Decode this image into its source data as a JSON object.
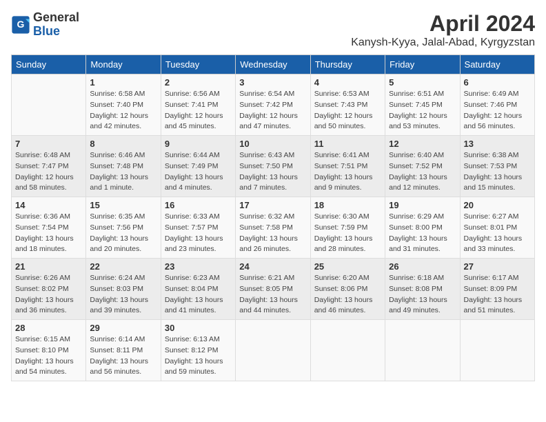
{
  "header": {
    "logo_line1": "General",
    "logo_line2": "Blue",
    "title": "April 2024",
    "location": "Kanysh-Kyya, Jalal-Abad, Kyrgyzstan"
  },
  "weekdays": [
    "Sunday",
    "Monday",
    "Tuesday",
    "Wednesday",
    "Thursday",
    "Friday",
    "Saturday"
  ],
  "weeks": [
    [
      {
        "day": "",
        "info": ""
      },
      {
        "day": "1",
        "info": "Sunrise: 6:58 AM\nSunset: 7:40 PM\nDaylight: 12 hours\nand 42 minutes."
      },
      {
        "day": "2",
        "info": "Sunrise: 6:56 AM\nSunset: 7:41 PM\nDaylight: 12 hours\nand 45 minutes."
      },
      {
        "day": "3",
        "info": "Sunrise: 6:54 AM\nSunset: 7:42 PM\nDaylight: 12 hours\nand 47 minutes."
      },
      {
        "day": "4",
        "info": "Sunrise: 6:53 AM\nSunset: 7:43 PM\nDaylight: 12 hours\nand 50 minutes."
      },
      {
        "day": "5",
        "info": "Sunrise: 6:51 AM\nSunset: 7:45 PM\nDaylight: 12 hours\nand 53 minutes."
      },
      {
        "day": "6",
        "info": "Sunrise: 6:49 AM\nSunset: 7:46 PM\nDaylight: 12 hours\nand 56 minutes."
      }
    ],
    [
      {
        "day": "7",
        "info": "Sunrise: 6:48 AM\nSunset: 7:47 PM\nDaylight: 12 hours\nand 58 minutes."
      },
      {
        "day": "8",
        "info": "Sunrise: 6:46 AM\nSunset: 7:48 PM\nDaylight: 13 hours\nand 1 minute."
      },
      {
        "day": "9",
        "info": "Sunrise: 6:44 AM\nSunset: 7:49 PM\nDaylight: 13 hours\nand 4 minutes."
      },
      {
        "day": "10",
        "info": "Sunrise: 6:43 AM\nSunset: 7:50 PM\nDaylight: 13 hours\nand 7 minutes."
      },
      {
        "day": "11",
        "info": "Sunrise: 6:41 AM\nSunset: 7:51 PM\nDaylight: 13 hours\nand 9 minutes."
      },
      {
        "day": "12",
        "info": "Sunrise: 6:40 AM\nSunset: 7:52 PM\nDaylight: 13 hours\nand 12 minutes."
      },
      {
        "day": "13",
        "info": "Sunrise: 6:38 AM\nSunset: 7:53 PM\nDaylight: 13 hours\nand 15 minutes."
      }
    ],
    [
      {
        "day": "14",
        "info": "Sunrise: 6:36 AM\nSunset: 7:54 PM\nDaylight: 13 hours\nand 18 minutes."
      },
      {
        "day": "15",
        "info": "Sunrise: 6:35 AM\nSunset: 7:56 PM\nDaylight: 13 hours\nand 20 minutes."
      },
      {
        "day": "16",
        "info": "Sunrise: 6:33 AM\nSunset: 7:57 PM\nDaylight: 13 hours\nand 23 minutes."
      },
      {
        "day": "17",
        "info": "Sunrise: 6:32 AM\nSunset: 7:58 PM\nDaylight: 13 hours\nand 26 minutes."
      },
      {
        "day": "18",
        "info": "Sunrise: 6:30 AM\nSunset: 7:59 PM\nDaylight: 13 hours\nand 28 minutes."
      },
      {
        "day": "19",
        "info": "Sunrise: 6:29 AM\nSunset: 8:00 PM\nDaylight: 13 hours\nand 31 minutes."
      },
      {
        "day": "20",
        "info": "Sunrise: 6:27 AM\nSunset: 8:01 PM\nDaylight: 13 hours\nand 33 minutes."
      }
    ],
    [
      {
        "day": "21",
        "info": "Sunrise: 6:26 AM\nSunset: 8:02 PM\nDaylight: 13 hours\nand 36 minutes."
      },
      {
        "day": "22",
        "info": "Sunrise: 6:24 AM\nSunset: 8:03 PM\nDaylight: 13 hours\nand 39 minutes."
      },
      {
        "day": "23",
        "info": "Sunrise: 6:23 AM\nSunset: 8:04 PM\nDaylight: 13 hours\nand 41 minutes."
      },
      {
        "day": "24",
        "info": "Sunrise: 6:21 AM\nSunset: 8:05 PM\nDaylight: 13 hours\nand 44 minutes."
      },
      {
        "day": "25",
        "info": "Sunrise: 6:20 AM\nSunset: 8:06 PM\nDaylight: 13 hours\nand 46 minutes."
      },
      {
        "day": "26",
        "info": "Sunrise: 6:18 AM\nSunset: 8:08 PM\nDaylight: 13 hours\nand 49 minutes."
      },
      {
        "day": "27",
        "info": "Sunrise: 6:17 AM\nSunset: 8:09 PM\nDaylight: 13 hours\nand 51 minutes."
      }
    ],
    [
      {
        "day": "28",
        "info": "Sunrise: 6:15 AM\nSunset: 8:10 PM\nDaylight: 13 hours\nand 54 minutes."
      },
      {
        "day": "29",
        "info": "Sunrise: 6:14 AM\nSunset: 8:11 PM\nDaylight: 13 hours\nand 56 minutes."
      },
      {
        "day": "30",
        "info": "Sunrise: 6:13 AM\nSunset: 8:12 PM\nDaylight: 13 hours\nand 59 minutes."
      },
      {
        "day": "",
        "info": ""
      },
      {
        "day": "",
        "info": ""
      },
      {
        "day": "",
        "info": ""
      },
      {
        "day": "",
        "info": ""
      }
    ]
  ]
}
